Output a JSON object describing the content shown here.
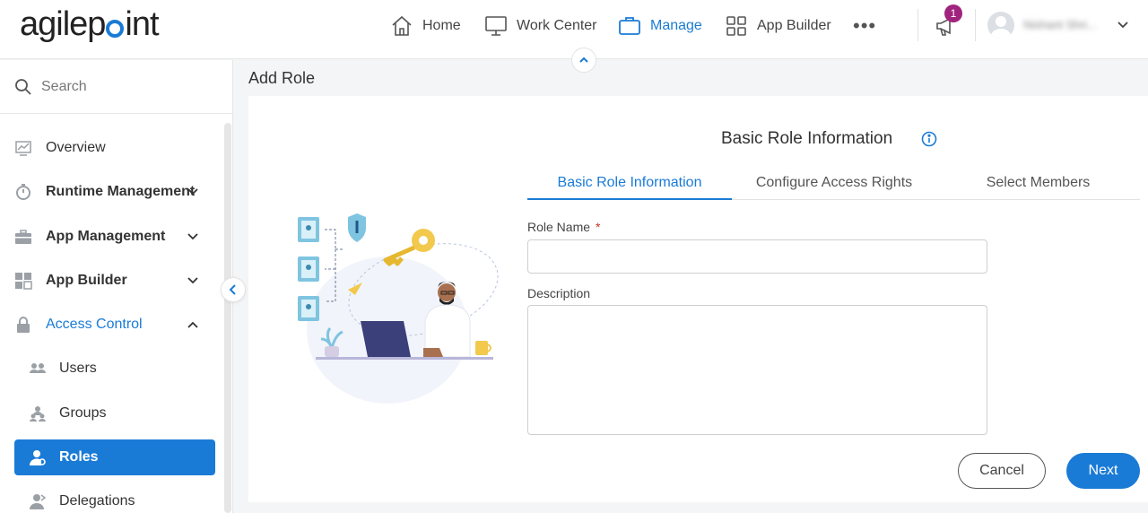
{
  "header": {
    "logo": "agilepoint",
    "nav": [
      {
        "label": "Home",
        "icon": "home-icon"
      },
      {
        "label": "Work Center",
        "icon": "monitor-icon"
      },
      {
        "label": "Manage",
        "icon": "briefcase-icon",
        "active": true
      },
      {
        "label": "App Builder",
        "icon": "grid-icon"
      }
    ],
    "more_icon": "more-dots-icon",
    "notification_count": "1",
    "user_name": "Nishant Shri..."
  },
  "sidebar": {
    "search_placeholder": "Search",
    "items": [
      {
        "label": "Overview",
        "icon": "chart-icon"
      },
      {
        "label": "Runtime Management",
        "icon": "timer-icon",
        "expandable": true
      },
      {
        "label": "App Management",
        "icon": "toolbox-icon",
        "expandable": true
      },
      {
        "label": "App Builder",
        "icon": "widgets-icon",
        "expandable": true
      },
      {
        "label": "Access Control",
        "icon": "lock-icon",
        "expanded": true
      },
      {
        "label": "Users",
        "icon": "users-icon"
      },
      {
        "label": "Groups",
        "icon": "groups-icon"
      },
      {
        "label": "Roles",
        "icon": "role-icon",
        "selected": true
      },
      {
        "label": "Delegations",
        "icon": "delegation-icon"
      }
    ]
  },
  "main": {
    "page_title": "Add Role",
    "form_heading": "Basic Role Information",
    "tabs": [
      {
        "label": "Basic Role Information",
        "active": true
      },
      {
        "label": "Configure Access Rights"
      },
      {
        "label": "Select Members"
      }
    ],
    "fields": {
      "role_name_label": "Role Name",
      "role_name_required": "*",
      "role_name_value": "",
      "description_label": "Description",
      "description_value": ""
    },
    "buttons": {
      "cancel": "Cancel",
      "next": "Next"
    }
  },
  "colors": {
    "accent": "#1a7bd6",
    "badge": "#a0247e",
    "required": "#c0392b"
  }
}
